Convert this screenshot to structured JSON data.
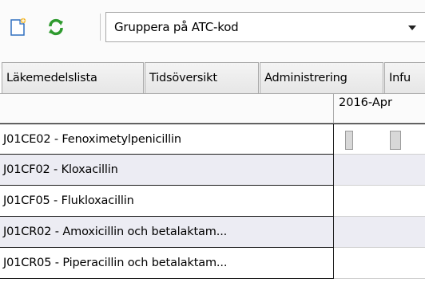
{
  "toolbar": {
    "new_icon": "new-document-icon",
    "refresh_icon": "refresh-icon",
    "group_by_selected": "Gruppera på ATC-kod"
  },
  "tabs": [
    {
      "label": "Läkemedelslista"
    },
    {
      "label": "Tidsöversikt"
    },
    {
      "label": "Administrering"
    },
    {
      "label": "Infu"
    }
  ],
  "timeline": {
    "period_label": "2016-Apr"
  },
  "rows": [
    {
      "label": "J01CE02 - Fenoximetylpenicillin"
    },
    {
      "label": "J01CF02 - Kloxacillin"
    },
    {
      "label": "J01CF05 - Flukloxacillin"
    },
    {
      "label": "J01CR02 - Amoxicillin och betalaktam..."
    },
    {
      "label": "J01CR05 - Piperacillin och betalaktam..."
    }
  ],
  "colors": {
    "alt_row": "#ececf3",
    "border": "#a9a9a9",
    "refresh_green": "#2e9a2e",
    "new_icon_accent": "#f2b21c"
  }
}
